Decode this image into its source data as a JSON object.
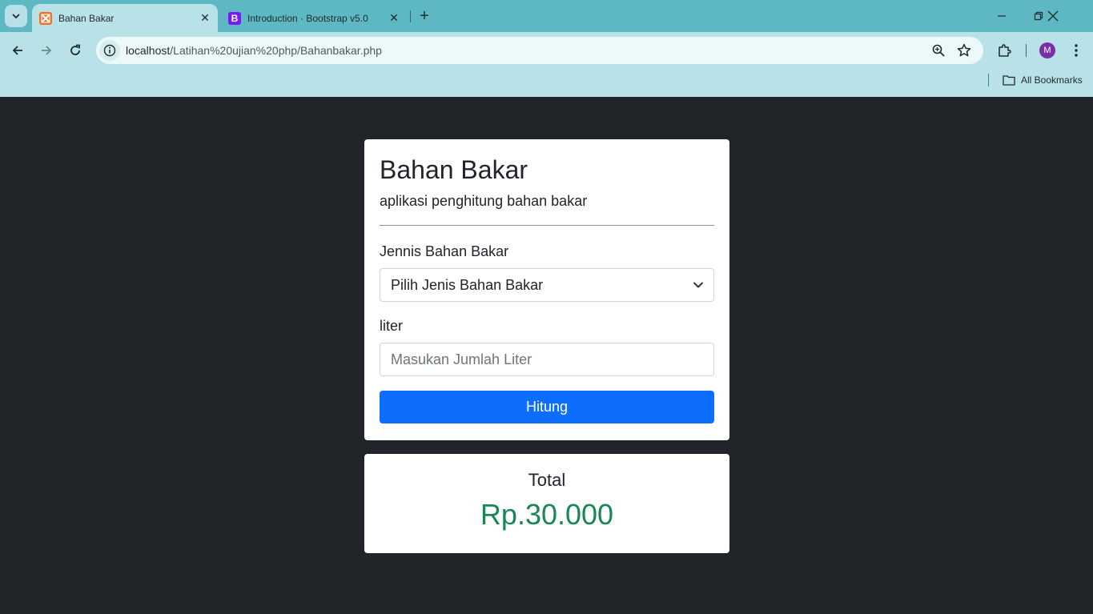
{
  "browser": {
    "tabs": [
      {
        "label": "Bahan Bakar",
        "active": true,
        "icon": "xampp-icon"
      },
      {
        "label": "Introduction · Bootstrap v5.0",
        "active": false,
        "icon": "bootstrap-icon",
        "favicon_text": "B"
      }
    ],
    "url_host": "localhost",
    "url_path": "/Latihan%20ujian%20php/Bahanbakar.php",
    "profile_initial": "M",
    "bookmarks_label": "All Bookmarks",
    "colors": {
      "titlebar": "#5db8c3",
      "toolbar": "#b8e2e7",
      "profile": "#7a2ea8"
    }
  },
  "page": {
    "title": "Bahan Bakar",
    "subtitle": "aplikasi penghitung bahan bakar",
    "fuel_label": "Jennis Bahan Bakar",
    "fuel_select_value": "Pilih Jenis Bahan Bakar",
    "liter_label": "liter",
    "liter_placeholder": "Masukan Jumlah Liter",
    "submit_label": "Hitung",
    "total_label": "Total",
    "total_value": "Rp.30.000",
    "colors": {
      "background": "#212529",
      "primary_button": "#0d6efd",
      "total_value": "#198754"
    }
  }
}
